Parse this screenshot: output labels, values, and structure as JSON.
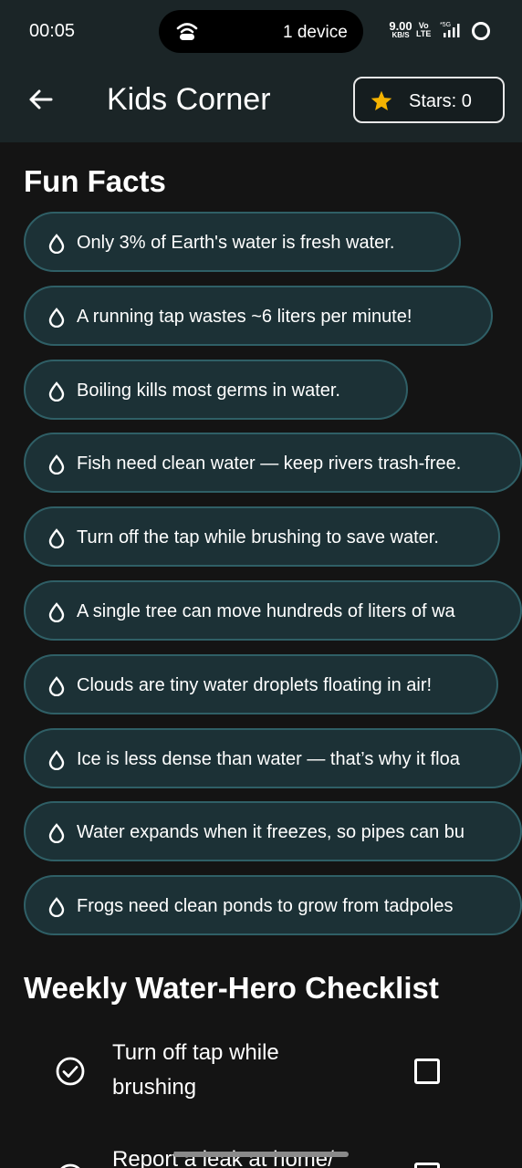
{
  "status_bar": {
    "time": "00:05",
    "island_text": "1 device",
    "net_speed_value": "9.00",
    "net_speed_unit": "KB/S",
    "volte_top": "Vo",
    "volte_bottom": "LTE",
    "signal_label": "*5G"
  },
  "app_bar": {
    "title": "Kids Corner",
    "stars_label": "Stars: 0"
  },
  "fun_facts": {
    "heading": "Fun Facts",
    "items": [
      "Only 3% of Earth's water is fresh water.",
      "A running tap wastes ~6 liters per minute!",
      "Boiling kills most germs in water.",
      "Fish need clean water — keep rivers trash-free.",
      "Turn off the tap while brushing to save water.",
      "A single tree can move hundreds of liters of wa",
      "Clouds are tiny water droplets floating in air!",
      "Ice is less dense than water — that’s why it floa",
      "Water expands when it freezes, so pipes can bu",
      "Frogs need clean ponds to grow from tadpoles"
    ]
  },
  "checklist": {
    "heading": "Weekly Water-Hero Checklist",
    "items": [
      {
        "line1": "Turn off tap while",
        "line2": "brushing",
        "checked": false
      },
      {
        "line1": "Report a leak at home/",
        "line2": "",
        "checked": false
      }
    ]
  },
  "colors": {
    "app_bar_bg": "#1b2527",
    "page_bg": "#141414",
    "chip_bg": "#1c3136",
    "chip_border": "#2f5f66",
    "star": "#f5b301"
  },
  "icons": {
    "back": "arrow-left-icon",
    "star": "star-icon",
    "fact": "water-drop-icon",
    "check": "check-circle-icon",
    "checkbox": "checkbox-icon"
  }
}
